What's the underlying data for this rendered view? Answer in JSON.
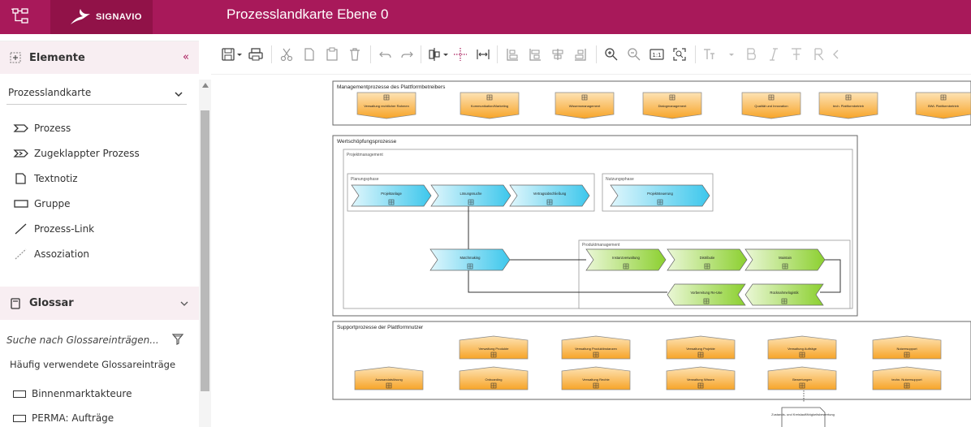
{
  "header": {
    "logo_text": "SIGNAVIO",
    "diagram_title": "Prozesslandkarte Ebene 0",
    "bar_color": "#a8195a"
  },
  "sidebar": {
    "elements_title": "Elemente",
    "collapse_glyph": "«",
    "dropdown_value": "Prozesslandkarte",
    "items": [
      {
        "label": "Prozess",
        "icon": "process-icon"
      },
      {
        "label": "Zugeklappter Prozess",
        "icon": "collapsed-process-icon"
      },
      {
        "label": "Textnotiz",
        "icon": "text-note-icon"
      },
      {
        "label": "Gruppe",
        "icon": "group-icon"
      },
      {
        "label": "Prozess-Link",
        "icon": "process-link-icon"
      },
      {
        "label": "Assoziation",
        "icon": "association-icon"
      }
    ],
    "glossary_title": "Glossar",
    "glossary_search_placeholder": "Suche nach Glossareinträgen...",
    "frequent_label": "Häufig verwendete Glossareinträge",
    "glossary_entries": [
      "Binnenmarktakteure",
      "PERMA: Aufträge"
    ]
  },
  "toolbar": {
    "icons": [
      "save-icon",
      "save-dropdown-icon",
      "print-icon",
      "cut-icon",
      "copy-icon",
      "paste-icon",
      "delete-icon",
      "undo-icon",
      "redo-icon",
      "align-icon",
      "align-dropdown-icon",
      "distribute-icon",
      "spacing-icon",
      "layout-1-icon",
      "layout-2-icon",
      "layout-3-icon",
      "layout-4-icon",
      "zoom-in-icon",
      "zoom-out-icon",
      "zoom-reset-icon",
      "zoom-fit-icon",
      "font-size-icon",
      "font-dropdown-icon",
      "bold-icon",
      "italic-icon",
      "text-style-icon",
      "format-icon"
    ]
  },
  "canvas": {
    "mgmt_group": "Managementprozesse des Plattformbetreibers",
    "mgmt_shapes": [
      "Verwaltung rechtlicher Rahmen",
      "Kommunikation/Marketing",
      "Wissensmanagement",
      "Dialogmanagement",
      "Qualität und Innovation",
      "tech. Plattformbetrieb",
      "BWL Plattformbetrieb"
    ],
    "value_group": "Wertschöpfungsprozesse",
    "pm_group": "Projektmanagement",
    "planning_group": "Planungsphase",
    "usage_group": "Nutzungsphase",
    "product_group": "Produktmanagement",
    "planning_shapes": [
      "Projektanlage",
      "Lösungssuche",
      "Vertragsabschließung"
    ],
    "usage_shapes": [
      "Projektsteuerung"
    ],
    "matchmaking": "Matchmaking",
    "product_row1": [
      "Instanzverwaltung",
      "Distributie",
      "Maintain"
    ],
    "product_row2": [
      "Vorbereitung Re-Use",
      "Rücknahmelogistik"
    ],
    "support_group": "Supportprozesse der Plattformnutzer",
    "support_row1": [
      "Verwaltung Produkte",
      "Verwaltung Produktinstanzen",
      "Verwaltung Projekte",
      "Verwaltung Aufträge",
      "Nutzersupport"
    ],
    "support_row2": [
      "Auswandatslösung",
      "Onboarding",
      "Verwaltung Rechte",
      "Verwaltung Wissen",
      "Bewertungen",
      "techn. Nutzersupport"
    ],
    "note_text": "Zustands- und Kreislauffähigkeitsbewertung",
    "colors": {
      "orange": "#f7a428",
      "blue": "#3dc7ec",
      "green": "#8cd030",
      "border": "#666666"
    }
  }
}
